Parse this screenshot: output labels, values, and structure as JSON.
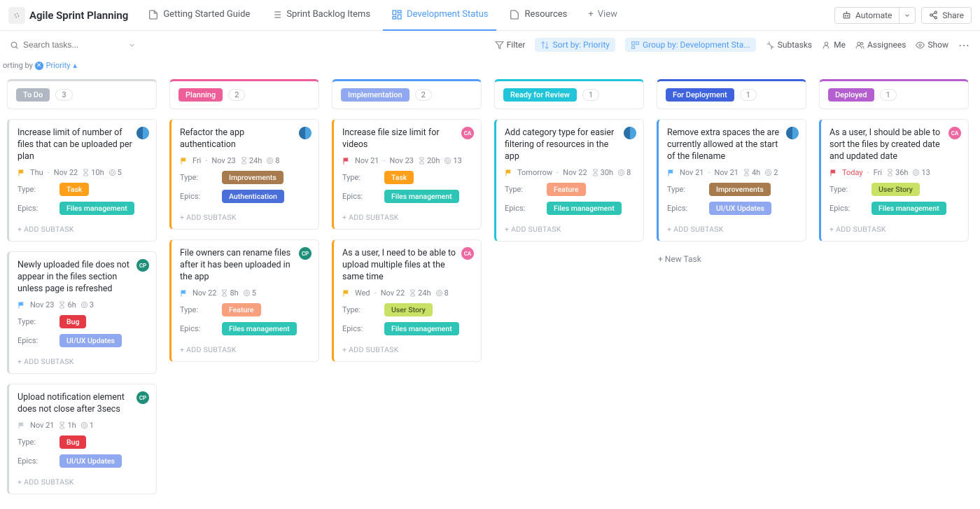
{
  "header": {
    "board_title": "Agile Sprint Planning",
    "tabs": [
      {
        "label": "Getting Started Guide"
      },
      {
        "label": "Sprint Backlog Items"
      },
      {
        "label": "Development Status"
      },
      {
        "label": "Resources"
      }
    ],
    "view_btn": "View",
    "automate": "Automate",
    "share": "Share"
  },
  "toolbar": {
    "search_placeholder": "Search tasks...",
    "filter": "Filter",
    "sort": "Sort by: Priority",
    "group": "Group by: Development Sta...",
    "subtasks": "Subtasks",
    "me": "Me",
    "assignees": "Assignees",
    "show": "Show"
  },
  "sortrow": {
    "prefix": "orting by",
    "chip": "Priority"
  },
  "labels": {
    "type": "Type:",
    "epics": "Epics:",
    "add_subtask": "+ ADD SUBTASK",
    "new_task": "+ New Task"
  },
  "columns": [
    {
      "name": "To Do",
      "count": "3",
      "accent": "accent-grey",
      "pill_class": "grey",
      "pill_bg": "",
      "cards": [
        {
          "title": "Increase limit of number of files that can be uploaded per plan",
          "avatar_class": "av-split",
          "avatar_text": "",
          "flag": "#f2b01e",
          "dates": [
            "Thu",
            "Nov 22"
          ],
          "hours": "10h",
          "pts": "5",
          "type": "Task",
          "type_class": "tag-task",
          "epic": "Files management",
          "epic_class": "tag-files",
          "card_class": "c-grey"
        },
        {
          "title": "Newly uploaded file does not appear in the files section unless page is refreshed",
          "avatar_class": "av-teal",
          "avatar_text": "CP",
          "flag": "#5bb0ff",
          "dates": [
            "Nov 23"
          ],
          "hours": "6h",
          "pts": "3",
          "type": "Bug",
          "type_class": "tag-bug",
          "epic": "UI/UX Updates",
          "epic_class": "tag-uiux",
          "card_class": "c-grey"
        },
        {
          "title": "Upload notification element does not close after 3secs",
          "avatar_class": "av-teal",
          "avatar_text": "CP",
          "flag": "#c7cdd6",
          "dates": [
            "Nov 21"
          ],
          "hours": "1h",
          "pts": "1",
          "type": "Bug",
          "type_class": "tag-bug",
          "epic": "UI/UX Updates",
          "epic_class": "tag-uiux",
          "card_class": "c-grey"
        }
      ]
    },
    {
      "name": "Planning",
      "count": "2",
      "accent": "accent-pink",
      "pill_bg": "#ee5e99",
      "cards": [
        {
          "title": "Refactor the app authentication",
          "avatar_class": "av-split",
          "avatar_text": "",
          "flag": "#f2b01e",
          "dates": [
            "Fri",
            "Nov 23"
          ],
          "hours": "24h",
          "pts": "8",
          "type": "Improvements",
          "type_class": "tag-improvements",
          "epic": "Authentication",
          "epic_class": "tag-auth",
          "card_class": "c-orange"
        },
        {
          "title": "File owners can rename files after it has been uploaded in the app",
          "avatar_class": "av-teal",
          "avatar_text": "CP",
          "flag": "#5bb0ff",
          "dates": [
            "Nov 22"
          ],
          "hours": "8h",
          "pts": "5",
          "type": "Feature",
          "type_class": "tag-feature",
          "epic": "Files management",
          "epic_class": "tag-files",
          "card_class": "c-orange"
        }
      ]
    },
    {
      "name": "Implementation",
      "count": "2",
      "accent": "accent-blue",
      "pill_bg": "#8fa8f0",
      "cards": [
        {
          "title": "Increase file size limit for videos",
          "avatar_class": "av-pink",
          "avatar_text": "CA",
          "flag": "#e04f5f",
          "dates": [
            "Nov 21",
            "Nov 23"
          ],
          "hours": "20h",
          "pts": "13",
          "type": "Task",
          "type_class": "tag-task",
          "epic": "Files management",
          "epic_class": "tag-files",
          "card_class": "c-orange"
        },
        {
          "title": "As a user, I need to be able to upload multiple files at the same time",
          "avatar_class": "av-pink",
          "avatar_text": "CA",
          "flag": "#f2b01e",
          "dates": [
            "Wed",
            "Nov 22"
          ],
          "hours": "24h",
          "pts": "8",
          "type": "User Story",
          "type_class": "tag-userstory",
          "epic": "Files management",
          "epic_class": "tag-files",
          "card_class": "c-orange"
        }
      ]
    },
    {
      "name": "Ready for Review",
      "count": "1",
      "accent": "accent-teal",
      "pill_bg": "#21c4d9",
      "cards": [
        {
          "title": "Add category type for easier filtering of resources in the app",
          "avatar_class": "av-split",
          "avatar_text": "",
          "flag": "#f2b01e",
          "dates": [
            "Tomorrow",
            "Nov 22"
          ],
          "hours": "30h",
          "pts": "8",
          "type": "Feature",
          "type_class": "tag-feature",
          "epic": "Files management",
          "epic_class": "tag-files",
          "card_class": "c-teal"
        }
      ]
    },
    {
      "name": "For Deployment",
      "count": "1",
      "accent": "accent-navy",
      "pill_bg": "#3e63dd",
      "show_new_task": true,
      "cards": [
        {
          "title": "Remove extra spaces the are currently allowed at the start of the filename",
          "avatar_class": "av-split",
          "avatar_text": "",
          "flag": "#5bb0ff",
          "dates": [
            "Nov 21",
            "Nov 21"
          ],
          "hours": "4h",
          "pts": "2",
          "type": "Improvements",
          "type_class": "tag-improvements",
          "epic": "UI/UX Updates",
          "epic_class": "tag-uiux",
          "card_class": "c-blue"
        }
      ]
    },
    {
      "name": "Deployed",
      "count": "1",
      "accent": "accent-purple",
      "pill_bg": "#b45ecf",
      "cards": [
        {
          "title": "As a user, I should be able to sort the files by created date and updated date",
          "avatar_class": "av-pink",
          "avatar_text": "CA",
          "flag": "#e04f5f",
          "dates": [
            "Today",
            "Fri"
          ],
          "dates_colors": [
            "#e04f5f",
            ""
          ],
          "hours": "36h",
          "pts": "13",
          "type": "User Story",
          "type_class": "tag-userstory",
          "epic": "Files management",
          "epic_class": "tag-files",
          "card_class": "c-blue"
        }
      ]
    }
  ]
}
